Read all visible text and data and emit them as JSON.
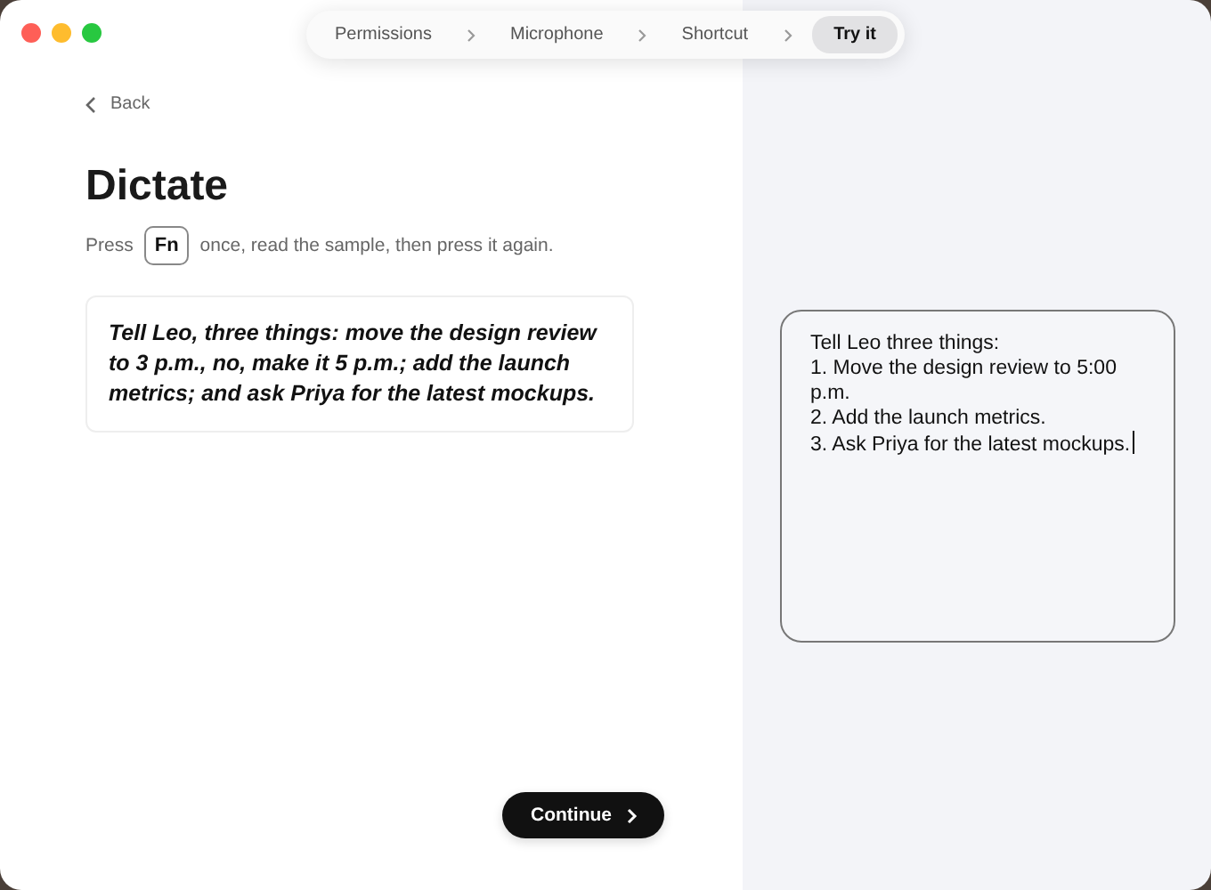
{
  "steps": [
    {
      "label": "Permissions",
      "selected": false
    },
    {
      "label": "Microphone",
      "selected": false
    },
    {
      "label": "Shortcut",
      "selected": false
    },
    {
      "label": "Try it",
      "selected": true
    }
  ],
  "back": "Back",
  "title": "Dictate",
  "instruction": {
    "before": "Press",
    "key": "Fn",
    "after": "once, read the sample, then press it again."
  },
  "sample": "Tell Leo, three things: move the design review to 3 p.m., no, make it 5 p.m.; add the launch metrics; and ask Priya for the latest mockups.",
  "output_lines": [
    "Tell Leo three things:",
    "1. Move the design review to 5:00 p.m.",
    "2. Add the launch metrics.",
    "3. Ask Priya for the latest mockups."
  ],
  "continue": "Continue"
}
